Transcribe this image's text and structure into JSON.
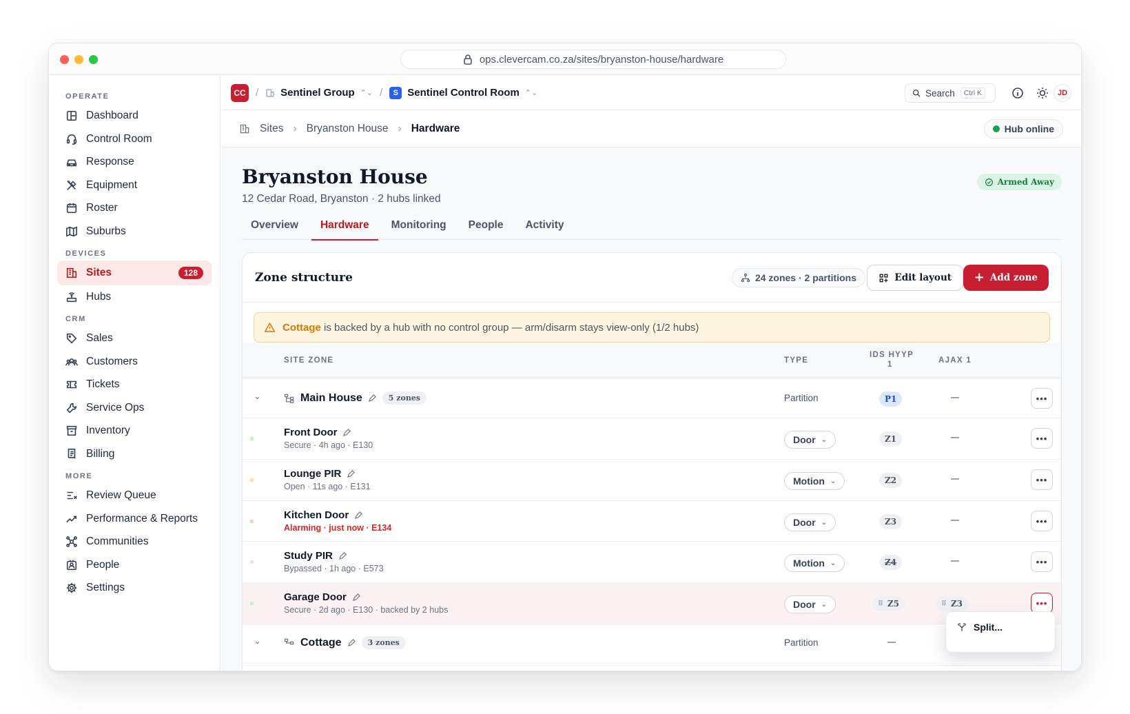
{
  "browser": {
    "url": "ops.clevercam.co.za/sites/bryanston-house/hardware"
  },
  "sidebar": {
    "sections": [
      "OPERATE",
      "DEVICES",
      "CRM",
      "MORE"
    ],
    "items": [
      {
        "label": "Dashboard",
        "icon": "dashboard-icon"
      },
      {
        "label": "Control Room",
        "icon": "headset-icon"
      },
      {
        "label": "Response",
        "icon": "car-icon"
      },
      {
        "label": "Equipment",
        "icon": "tools-icon"
      },
      {
        "label": "Roster",
        "icon": "calendar-icon"
      },
      {
        "label": "Suburbs",
        "icon": "map-icon"
      },
      {
        "label": "Sites",
        "icon": "building-icon",
        "badge": "128",
        "active": true
      },
      {
        "label": "Hubs",
        "icon": "router-icon"
      },
      {
        "label": "Sales",
        "icon": "tag-icon"
      },
      {
        "label": "Customers",
        "icon": "users-icon"
      },
      {
        "label": "Tickets",
        "icon": "ticket-icon"
      },
      {
        "label": "Service Ops",
        "icon": "wrench-icon"
      },
      {
        "label": "Inventory",
        "icon": "archive-icon"
      },
      {
        "label": "Billing",
        "icon": "receipt-icon"
      },
      {
        "label": "Review Queue",
        "icon": "list-check-icon"
      },
      {
        "label": "Performance & Reports",
        "icon": "trend-icon"
      },
      {
        "label": "Communities",
        "icon": "network-icon"
      },
      {
        "label": "People",
        "icon": "contact-icon"
      },
      {
        "label": "Settings",
        "icon": "gear-icon"
      }
    ]
  },
  "topbar": {
    "logo": "CC",
    "org": "Sentinel Group",
    "workspace_badge": "S",
    "workspace": "Sentinel Control Room",
    "search_label": "Search",
    "search_kbd": "Ctrl K",
    "avatar": "JD"
  },
  "breadcrumb": {
    "items": [
      "Sites",
      "Bryanston House",
      "Hardware"
    ],
    "hub_status": "Hub online"
  },
  "site": {
    "title": "Bryanston House",
    "subtitle": "12 Cedar Road, Bryanston · 2 hubs linked",
    "state": "Armed Away"
  },
  "tabs": [
    "Overview",
    "Hardware",
    "Monitoring",
    "People",
    "Activity"
  ],
  "card": {
    "title": "Zone structure",
    "summary": "24 zones · 2 partitions",
    "edit_label": "Edit layout",
    "add_label": "Add zone"
  },
  "warning": {
    "site": "Cottage",
    "text": "is backed by a hub with no control group — arm/disarm stays view-only (1/2 hubs)"
  },
  "table": {
    "columns": [
      "SITE ZONE",
      "TYPE",
      "IDS HYYP",
      "1",
      "AJAX 1"
    ],
    "partitions": [
      {
        "name": "Main House",
        "count": "5 zones",
        "type": "Partition",
        "ids": "P1",
        "ajax": "—"
      },
      {
        "name": "Cottage",
        "count": "3 zones",
        "type": "Partition",
        "ids": "",
        "ajax": "—"
      }
    ],
    "zones": [
      {
        "name": "Front Door",
        "meta": "Secure · 4h ago · E130",
        "type": "Door",
        "ids": "Z1",
        "ajax": "—",
        "status": "secure"
      },
      {
        "name": "Lounge PIR",
        "meta": "Open · 11s ago · E131",
        "type": "Motion",
        "ids": "Z2",
        "ajax": "—",
        "status": "open"
      },
      {
        "name": "Kitchen Door",
        "meta": "Alarming · just now · E134",
        "type": "Door",
        "ids": "Z3",
        "ajax": "—",
        "status": "alarm"
      },
      {
        "name": "Study PIR",
        "meta": "Bypassed · 1h ago · E573",
        "type": "Motion",
        "ids": "Z4",
        "ajax": "—",
        "status": "bypassed"
      },
      {
        "name": "Garage Door",
        "meta": "Secure · 2d ago · E130 · backed by 2 hubs",
        "type": "Door",
        "ids": "Z5",
        "ajax": "Z3",
        "status": "secure"
      }
    ],
    "more_symbol": "•••"
  },
  "context_menu": {
    "item": "Split..."
  },
  "colors": {
    "accent": "#c81e32",
    "online": "#16a34a",
    "warning_bg": "#fef5e0"
  }
}
